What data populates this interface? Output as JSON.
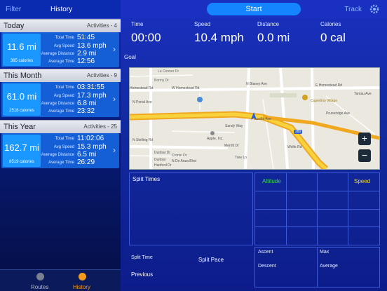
{
  "left_panel": {
    "filter_label": "Filter",
    "title": "History",
    "sections": [
      {
        "title": "Today",
        "count": "Activities - 4",
        "distance": "11.6 mi",
        "calories": "385 calories",
        "stats": [
          {
            "label": "Total Time",
            "value": "51:45"
          },
          {
            "label": "Avg Speed",
            "value": "13.6 mph"
          },
          {
            "label": "Average Distance",
            "value": "2.9 mi"
          },
          {
            "label": "Average Time",
            "value": "12:56"
          }
        ]
      },
      {
        "title": "This Month",
        "count": "Activities - 9",
        "distance": "61.0 mi",
        "calories": "2518 calories",
        "stats": [
          {
            "label": "Total Time",
            "value": "03:31:55"
          },
          {
            "label": "Avg Speed",
            "value": "17.3 mph"
          },
          {
            "label": "Average Distance",
            "value": "6.8 mi"
          },
          {
            "label": "Average Time",
            "value": "23:32"
          }
        ]
      },
      {
        "title": "This Year",
        "count": "Activities - 25",
        "distance": "162.7 mi",
        "calories": "8519 calories",
        "stats": [
          {
            "label": "Total Time",
            "value": "11:02:06"
          },
          {
            "label": "Avg Speed",
            "value": "15.3 mph"
          },
          {
            "label": "Average Distance",
            "value": "6.5 mi"
          },
          {
            "label": "Average Time",
            "value": "26:29"
          }
        ]
      }
    ],
    "tabs": [
      {
        "label": "Routes",
        "icon": "routes-icon",
        "active": false
      },
      {
        "label": "History",
        "icon": "history-icon",
        "active": true
      }
    ]
  },
  "right_panel": {
    "start_label": "Start",
    "track_label": "Track",
    "metrics": [
      {
        "label": "Time",
        "value": "00:00"
      },
      {
        "label": "Speed",
        "value": "10.4 mph"
      },
      {
        "label": "Distance",
        "value": "0.0 mi"
      },
      {
        "label": "Calories",
        "value": "0 cal"
      }
    ],
    "goal_label": "Goal",
    "map": {
      "streets": [
        "La Conner Dr",
        "Bonny Dr",
        "W Homestead Rd",
        "E Homestead Rd",
        "Homestead Rd",
        "N Blaney Ave",
        "Lucille Ave",
        "Apple, Inc.",
        "Cupertino Village",
        "Pruneridge Ave",
        "Dunbar Dr",
        "Dunbar",
        "Hanford Dr",
        "Merritt Dr",
        "Wolfe Rd",
        "Tantau Ave",
        "N De Anza Blvd",
        "N Stelling Rd",
        "N Portal Ave",
        "Cronin Dr",
        "Tree Ln",
        "Sandy Way"
      ],
      "highway_badge": "280",
      "zoom_in": "+",
      "zoom_out": "−"
    },
    "split_times_label": "Split Times",
    "altitude_label": "Altitude",
    "speed_label": "Speed",
    "split_time_label": "Split Time",
    "split_pace_label": "Split Pace",
    "previous_label": "Previous",
    "ascent_label": "Ascent",
    "max_label": "Max",
    "descent_label": "Descent",
    "average_label": "Average",
    "colors": {
      "accent": "#1585ff",
      "altitude": "#3cd84a",
      "speed": "#f2d633"
    }
  }
}
